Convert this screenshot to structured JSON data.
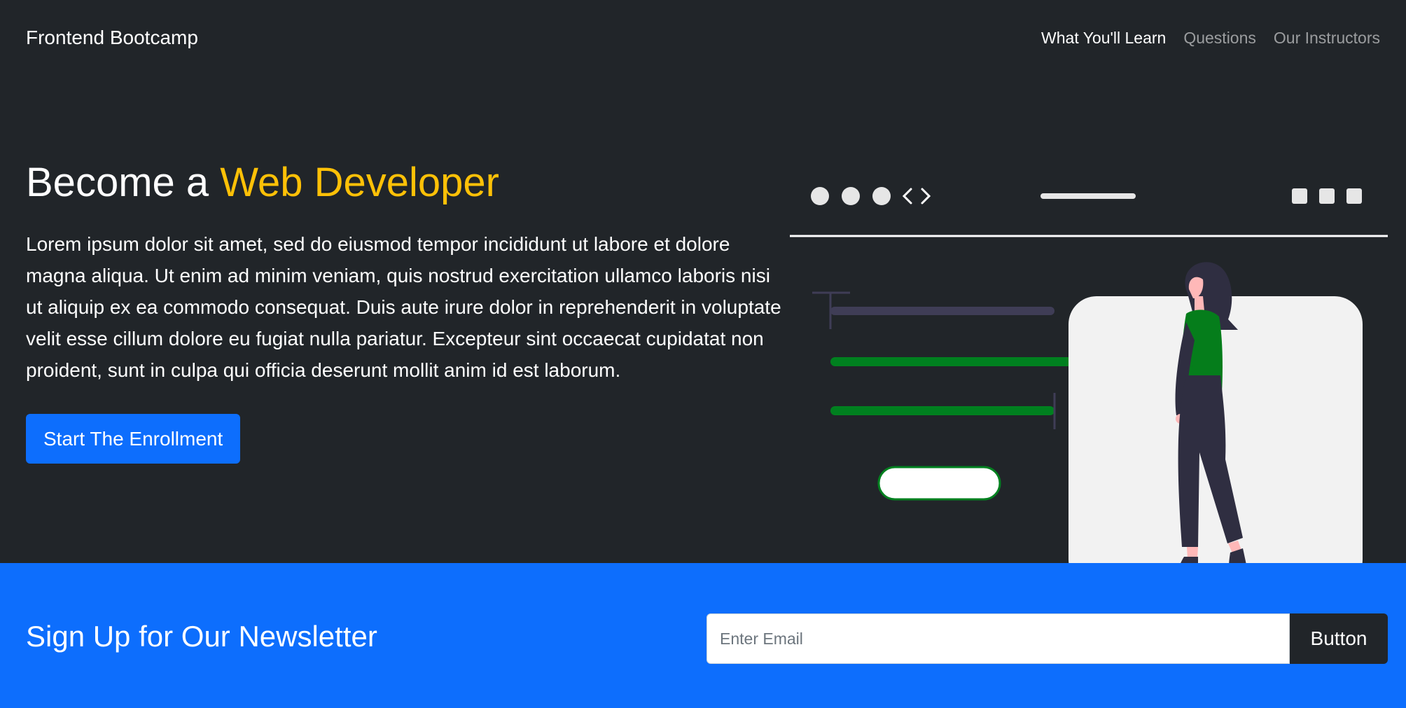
{
  "navbar": {
    "brand": "Frontend Bootcamp",
    "links": [
      {
        "label": "What You'll Learn",
        "active": true
      },
      {
        "label": "Questions",
        "active": false
      },
      {
        "label": "Our Instructors",
        "active": false
      }
    ]
  },
  "hero": {
    "title_prefix": "Become a ",
    "title_accent": "Web Developer",
    "lead": "Lorem ipsum dolor sit amet, sed do eiusmod tempor incididunt ut labore et dolore magna aliqua. Ut enim ad minim veniam, quis nostrud exercitation ullamco laboris nisi ut aliquip ex ea commodo consequat. Duis aute irure dolor in reprehenderit in voluptate velit esse cillum dolore eu fugiat nulla pariatur. Excepteur sint occaecat cupidatat non proident, sunt in culpa qui officia deserunt mollit anim id est laborum.",
    "cta_label": "Start The Enrollment"
  },
  "newsletter": {
    "title": "Sign Up for Our Newsletter",
    "email_placeholder": "Enter Email",
    "button_label": "Button"
  },
  "colors": {
    "dark": "#212529",
    "accent": "#ffc107",
    "primary": "#0d6efd",
    "illustration_green": "#00801f",
    "illustration_shirt": "#057d1b",
    "illustration_card": "#f2f2f2"
  }
}
